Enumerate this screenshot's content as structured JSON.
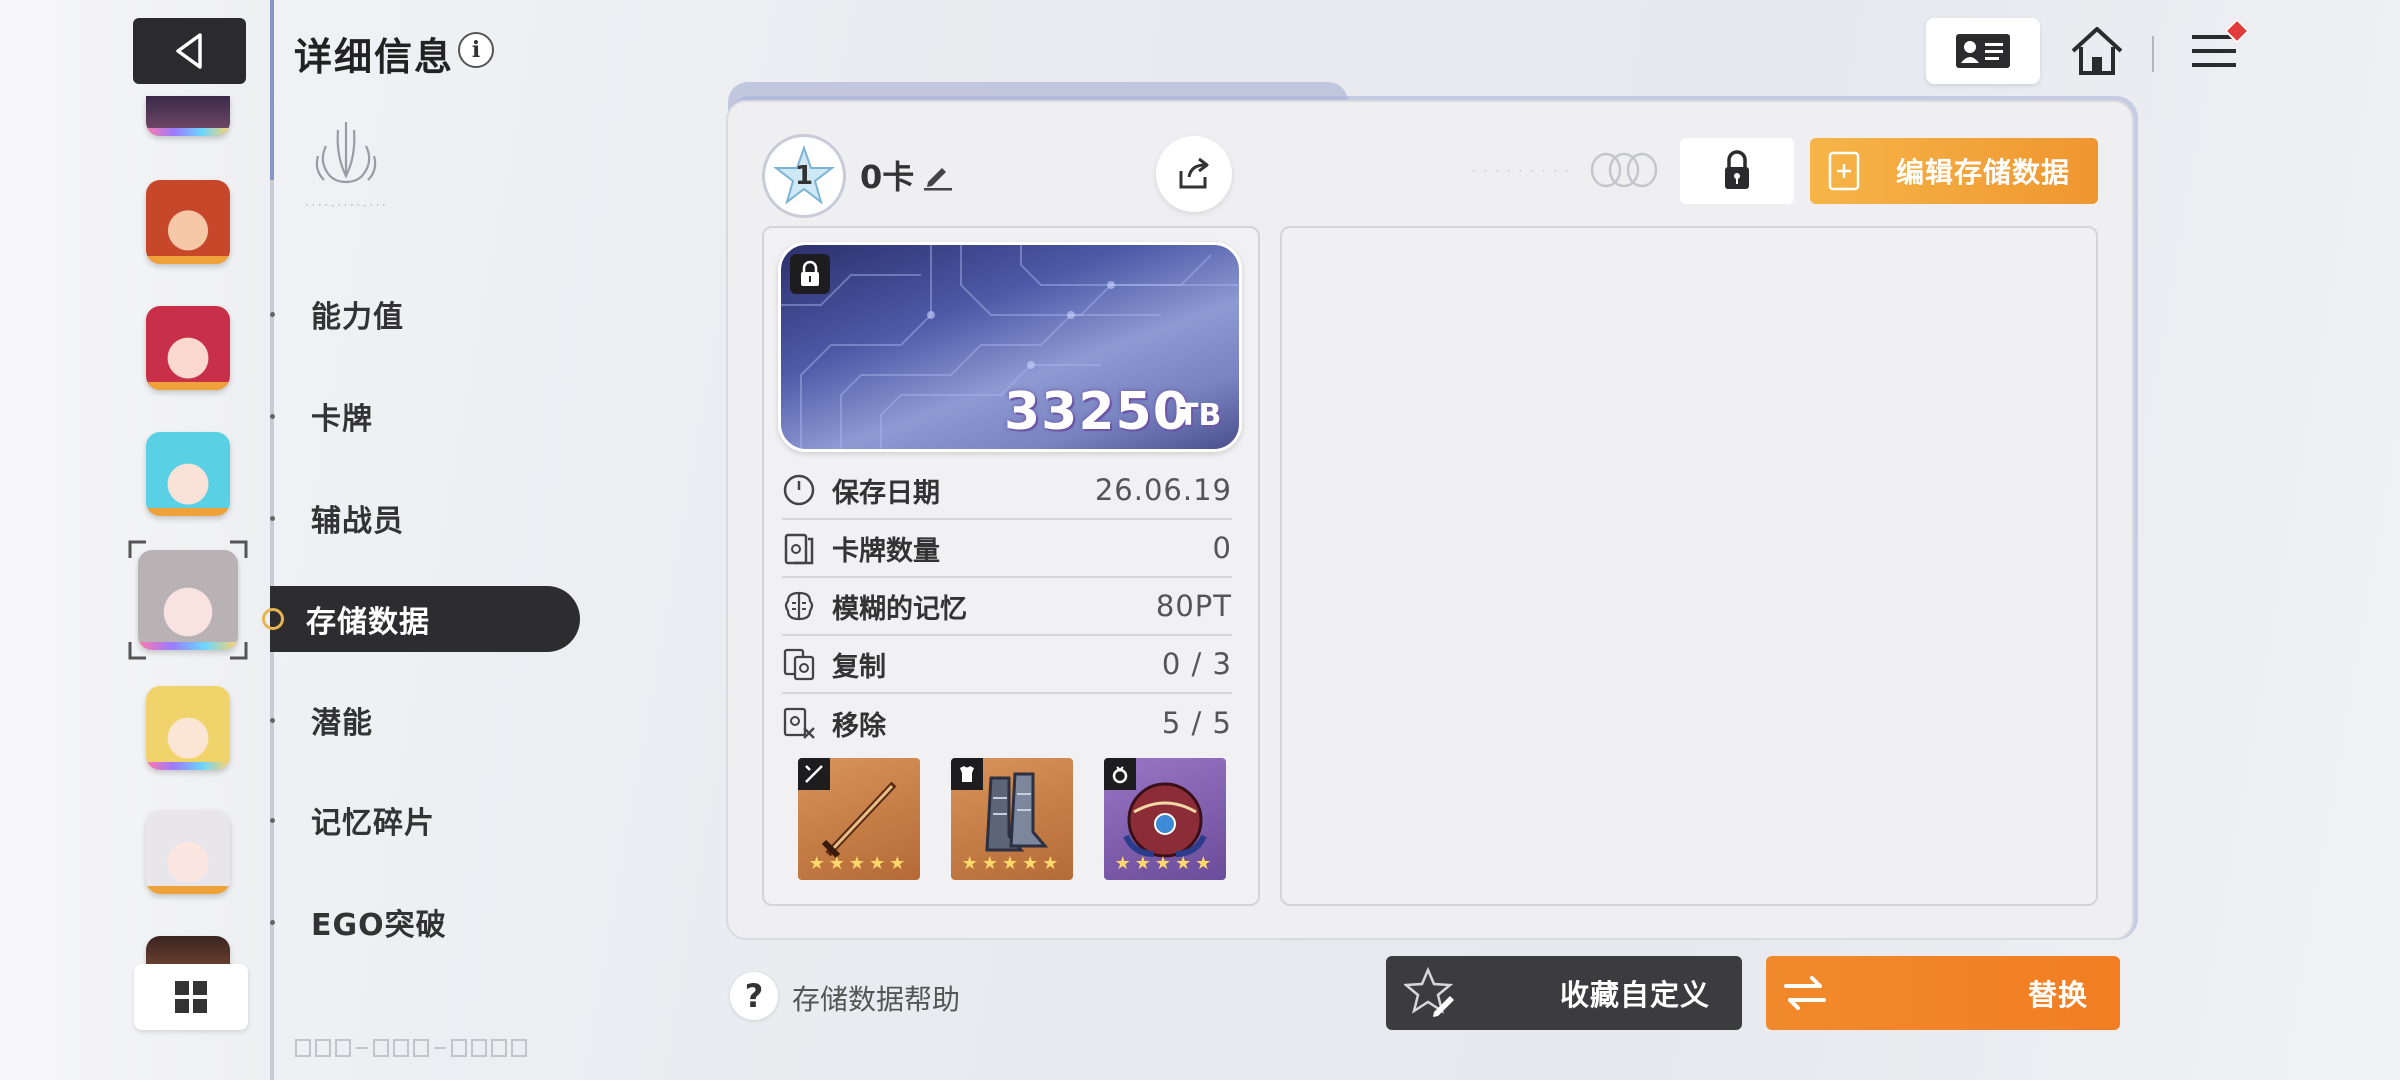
{
  "header": {
    "title": "详细信息",
    "info_icon": "info-icon"
  },
  "nav": {
    "items": [
      {
        "label": "能力值"
      },
      {
        "label": "卡牌"
      },
      {
        "label": "辅战员"
      },
      {
        "label": "存储数据",
        "active": true
      },
      {
        "label": "潜能"
      },
      {
        "label": "记忆碎片"
      },
      {
        "label": "EGO突破"
      }
    ]
  },
  "deck": {
    "star_level": "1",
    "name": "0卡"
  },
  "storage_card": {
    "value": "33250",
    "unit": "TB"
  },
  "stats": [
    {
      "icon": "clock-icon",
      "label": "保存日期",
      "value": "26.06.19"
    },
    {
      "icon": "cards-icon",
      "label": "卡牌数量",
      "value": "0"
    },
    {
      "icon": "brain-icon",
      "label": "模糊的记忆",
      "value": "80PT"
    },
    {
      "icon": "copy-icon",
      "label": "复制",
      "value": "0 / 3"
    },
    {
      "icon": "remove-icon",
      "label": "移除",
      "value": "5 / 5"
    }
  ],
  "equipment": [
    {
      "slot": "weapon",
      "stars": "★★★★★",
      "color": "#c7753f"
    },
    {
      "slot": "armor",
      "stars": "★★★★★",
      "color": "#c7753f"
    },
    {
      "slot": "ring",
      "stars": "★★★★★",
      "color": "#7a5aa8"
    }
  ],
  "actions": {
    "edit_save": "编辑存储数据",
    "help": "存储数据帮助",
    "collect": "收藏自定义",
    "replace": "替换"
  },
  "colors": {
    "accent_orange": "#f18a2c",
    "dark": "#2d2d2f",
    "panel_blue": "#a8b1d8"
  }
}
